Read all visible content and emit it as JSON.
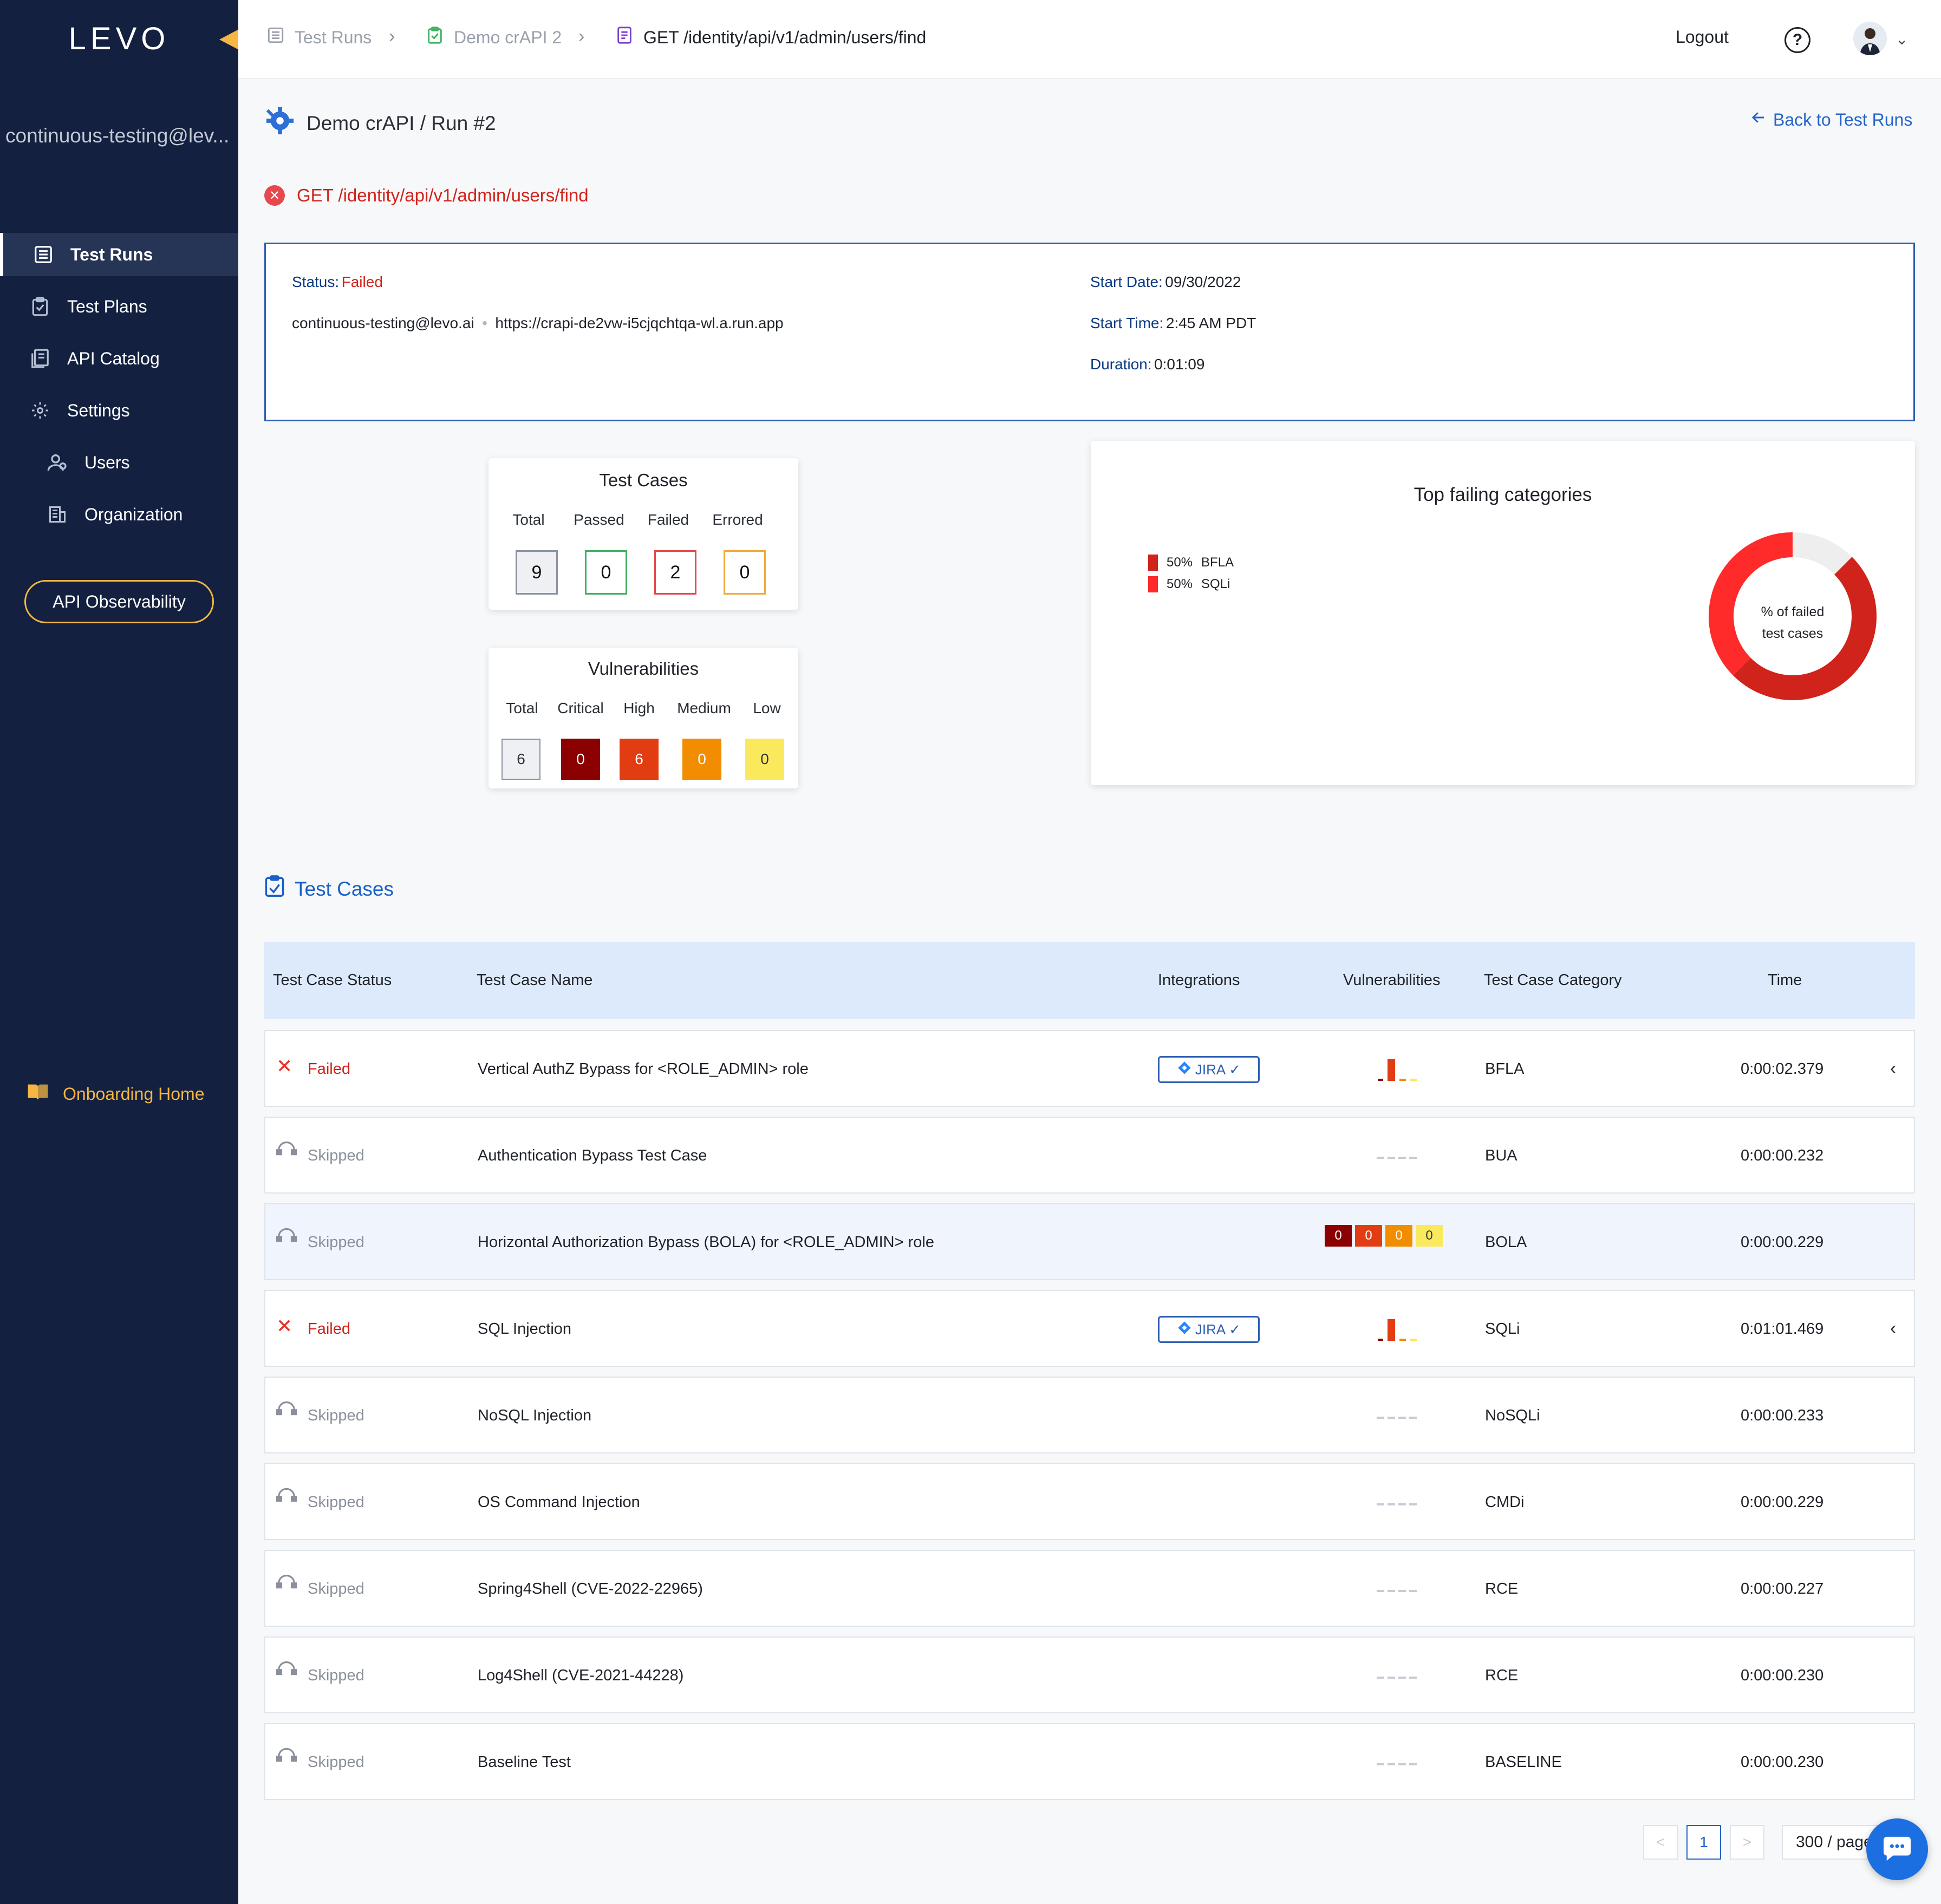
{
  "sidebar": {
    "logo": "LEVO",
    "org_email": "continuous-testing@lev...",
    "items": [
      {
        "label": "Test Runs",
        "icon": "list-icon"
      },
      {
        "label": "Test Plans",
        "icon": "clipboard-icon"
      },
      {
        "label": "API Catalog",
        "icon": "catalog-icon"
      },
      {
        "label": "Settings",
        "icon": "gear-icon"
      },
      {
        "label": "Users",
        "icon": "users-icon"
      },
      {
        "label": "Organization",
        "icon": "building-icon"
      }
    ],
    "observability_label": "API Observability",
    "onboarding_label": "Onboarding Home"
  },
  "topbar": {
    "breadcrumbs": [
      "Test Runs",
      "Demo crAPI 2",
      "GET /identity/api/v1/admin/users/find"
    ],
    "logout": "Logout",
    "help": "?"
  },
  "header": {
    "run_title": "Demo crAPI / Run #2",
    "back_label": "Back to Test Runs",
    "endpoint": "GET /identity/api/v1/admin/users/find"
  },
  "info": {
    "status_label": "Status:",
    "status_value": "Failed",
    "user": "continuous-testing@levo.ai",
    "separator": "•",
    "url": "https://crapi-de2vw-i5cjqchtqa-wl.a.run.app",
    "start_date_label": "Start Date:",
    "start_date": "09/30/2022",
    "start_time_label": "Start Time:",
    "start_time": "2:45 AM PDT",
    "duration_label": "Duration:",
    "duration": "0:01:09"
  },
  "test_cases_card": {
    "title": "Test Cases",
    "labels": [
      "Total",
      "Passed",
      "Failed",
      "Errored"
    ],
    "values": [
      "9",
      "0",
      "2",
      "0"
    ],
    "colors": [
      "#8b93a1",
      "#3fb061",
      "#e5484d",
      "#f2a93b"
    ]
  },
  "vulnerabilities_card": {
    "title": "Vulnerabilities",
    "labels": [
      "Total",
      "Critical",
      "High",
      "Medium",
      "Low"
    ],
    "values": [
      "6",
      "0",
      "6",
      "0",
      "0"
    ],
    "colors": [
      "#eef0f4",
      "#8b0000",
      "#e23d12",
      "#f28c00",
      "#fbe95d"
    ]
  },
  "top_failing": {
    "title": "Top failing categories",
    "legend": [
      {
        "pct": "50%",
        "name": "BFLA",
        "color": "#d0231b"
      },
      {
        "pct": "50%",
        "name": "SQLi",
        "color": "#ff2a2a"
      }
    ],
    "center_line1": "% of failed",
    "center_line2": "test cases",
    "slices": [
      50,
      50
    ]
  },
  "table": {
    "section_title": "Test Cases",
    "headers": [
      "Test Case Status",
      "Test Case Name",
      "Integrations",
      "Vulnerabilities",
      "Test Case Category",
      "Time"
    ],
    "rows": [
      {
        "status": "Failed",
        "name": "Vertical AuthZ Bypass for <ROLE_ADMIN> role",
        "integration": "JIRA",
        "vuln": "spark",
        "category": "BFLA",
        "time": "0:00:02.379"
      },
      {
        "status": "Skipped",
        "name": "Authentication Bypass Test Case",
        "integration": "",
        "vuln": "none",
        "category": "BUA",
        "time": "0:00:00.232"
      },
      {
        "status": "Skipped",
        "name": "Horizontal Authorization Bypass (BOLA) for <ROLE_ADMIN> role",
        "integration": "",
        "vuln": "counts",
        "vuln_counts": [
          "0",
          "0",
          "0",
          "0"
        ],
        "category": "BOLA",
        "time": "0:00:00.229"
      },
      {
        "status": "Failed",
        "name": "SQL Injection",
        "integration": "JIRA",
        "vuln": "spark",
        "category": "SQLi",
        "time": "0:01:01.469"
      },
      {
        "status": "Skipped",
        "name": "NoSQL Injection",
        "integration": "",
        "vuln": "none",
        "category": "NoSQLi",
        "time": "0:00:00.233"
      },
      {
        "status": "Skipped",
        "name": "OS Command Injection",
        "integration": "",
        "vuln": "none",
        "category": "CMDi",
        "time": "0:00:00.229"
      },
      {
        "status": "Skipped",
        "name": "Spring4Shell (CVE-2022-22965)",
        "integration": "",
        "vuln": "none",
        "category": "RCE",
        "time": "0:00:00.227"
      },
      {
        "status": "Skipped",
        "name": "Log4Shell (CVE-2021-44228)",
        "integration": "",
        "vuln": "none",
        "category": "RCE",
        "time": "0:00:00.230"
      },
      {
        "status": "Skipped",
        "name": "Baseline Test",
        "integration": "",
        "vuln": "none",
        "category": "BASELINE",
        "time": "0:00:00.230"
      }
    ]
  },
  "pagination": {
    "prev": "<",
    "current": "1",
    "next": ">",
    "page_size": "300 / page"
  }
}
